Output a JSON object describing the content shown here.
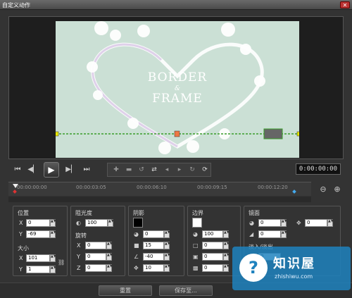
{
  "window": {
    "title": "自定义动作",
    "close_glyph": "✕"
  },
  "preview": {
    "line1": "BORDER",
    "line2": "&",
    "line3": "FRAME"
  },
  "transport": {
    "buttons": [
      {
        "name": "go-start-button",
        "glyph": "⏮"
      },
      {
        "name": "prev-frame-button",
        "glyph": "◀▏"
      },
      {
        "name": "next-frame-button",
        "glyph": "▶▏"
      },
      {
        "name": "go-end-button",
        "glyph": "⏭"
      }
    ],
    "play_glyph": "▶",
    "timecode": "0:00:00:00"
  },
  "timeline": {
    "ticks": [
      "00:00:00:00",
      "00:00:03:05",
      "00:00:06:10",
      "00:00:09:15",
      "00:00:12:20"
    ],
    "zoom_out_glyph": "⊖",
    "zoom_in_glyph": "⊕"
  },
  "position": {
    "label": "位置",
    "x_label": "X",
    "y_label": "Y",
    "x": "0",
    "y": "-69"
  },
  "size": {
    "label": "大小",
    "x_label": "X",
    "y_label": "Y",
    "x": "101",
    "y": "1"
  },
  "opacity": {
    "label": "阻光度",
    "value": "100"
  },
  "rotation": {
    "label": "旋转",
    "x_label": "X",
    "y_label": "Y",
    "z_label": "Z",
    "x": "0",
    "y": "0",
    "z": "0"
  },
  "shadow": {
    "label": "阴影",
    "values": [
      "0",
      "15",
      "-40",
      "10"
    ],
    "swatch_color": "#000000"
  },
  "border": {
    "label": "边界",
    "values": [
      "100",
      "0",
      "0",
      "0"
    ],
    "swatch_color": "#ffffff"
  },
  "mirror": {
    "label": "镜面",
    "values": [
      "0",
      "0",
      "0",
      "0"
    ]
  },
  "fade": {
    "label": "淡入/淡出"
  },
  "bottom": {
    "reset": "重置",
    "save_to": "保存至..."
  },
  "watermark": {
    "logo": "?",
    "name": "知识屋",
    "url": "zhishiwu.com"
  }
}
